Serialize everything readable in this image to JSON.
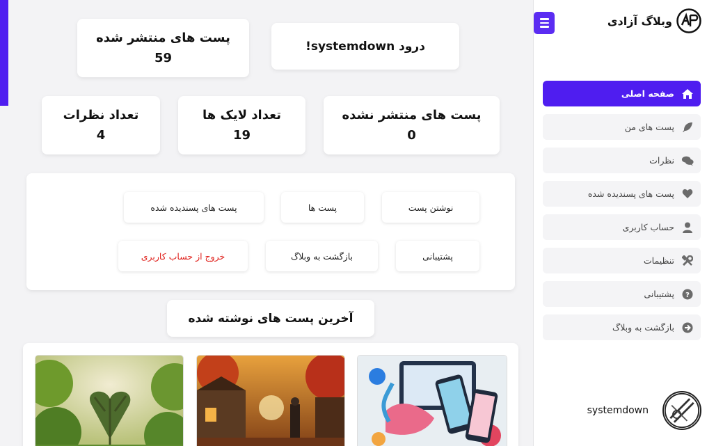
{
  "brand": {
    "title": "وبلاگ آزادی"
  },
  "stats": {
    "published_label": "پست های منتشر شده",
    "published_value": "59",
    "greeting": "درود systemdown!",
    "unpublished_label": "پست های منتشر نشده",
    "unpublished_value": "0",
    "likes_label": "تعداد لایک ها",
    "likes_value": "19",
    "comments_label": "تعداد نظرات",
    "comments_value": "4"
  },
  "actions": {
    "write_post": "نوشتن پست",
    "posts": "پست ها",
    "liked_posts": "پست های پسندیده شده",
    "support": "پشتیبانی",
    "back_to_blog": "بازگشت به وبلاگ",
    "logout": "خروج از حساب کاربری"
  },
  "latest": {
    "heading": "آخرین پست های نوشته شده"
  },
  "sidebar": {
    "items": [
      {
        "label": "صفحه اصلی",
        "icon": "home-icon"
      },
      {
        "label": "پست های من",
        "icon": "feather-icon"
      },
      {
        "label": "نظرات",
        "icon": "comments-icon"
      },
      {
        "label": "پست های پسندیده شده",
        "icon": "heart-icon"
      },
      {
        "label": "حساب کاربری",
        "icon": "user-icon"
      },
      {
        "label": "تنظیمات",
        "icon": "tools-icon"
      },
      {
        "label": "پشتیبانی",
        "icon": "question-icon"
      },
      {
        "label": "بازگشت به وبلاگ",
        "icon": "arrow-circle-icon"
      }
    ]
  },
  "user": {
    "name": "systemdown"
  },
  "colors": {
    "accent": "#4f1df0",
    "danger": "#e0231e",
    "background": "#f3f3f5"
  }
}
